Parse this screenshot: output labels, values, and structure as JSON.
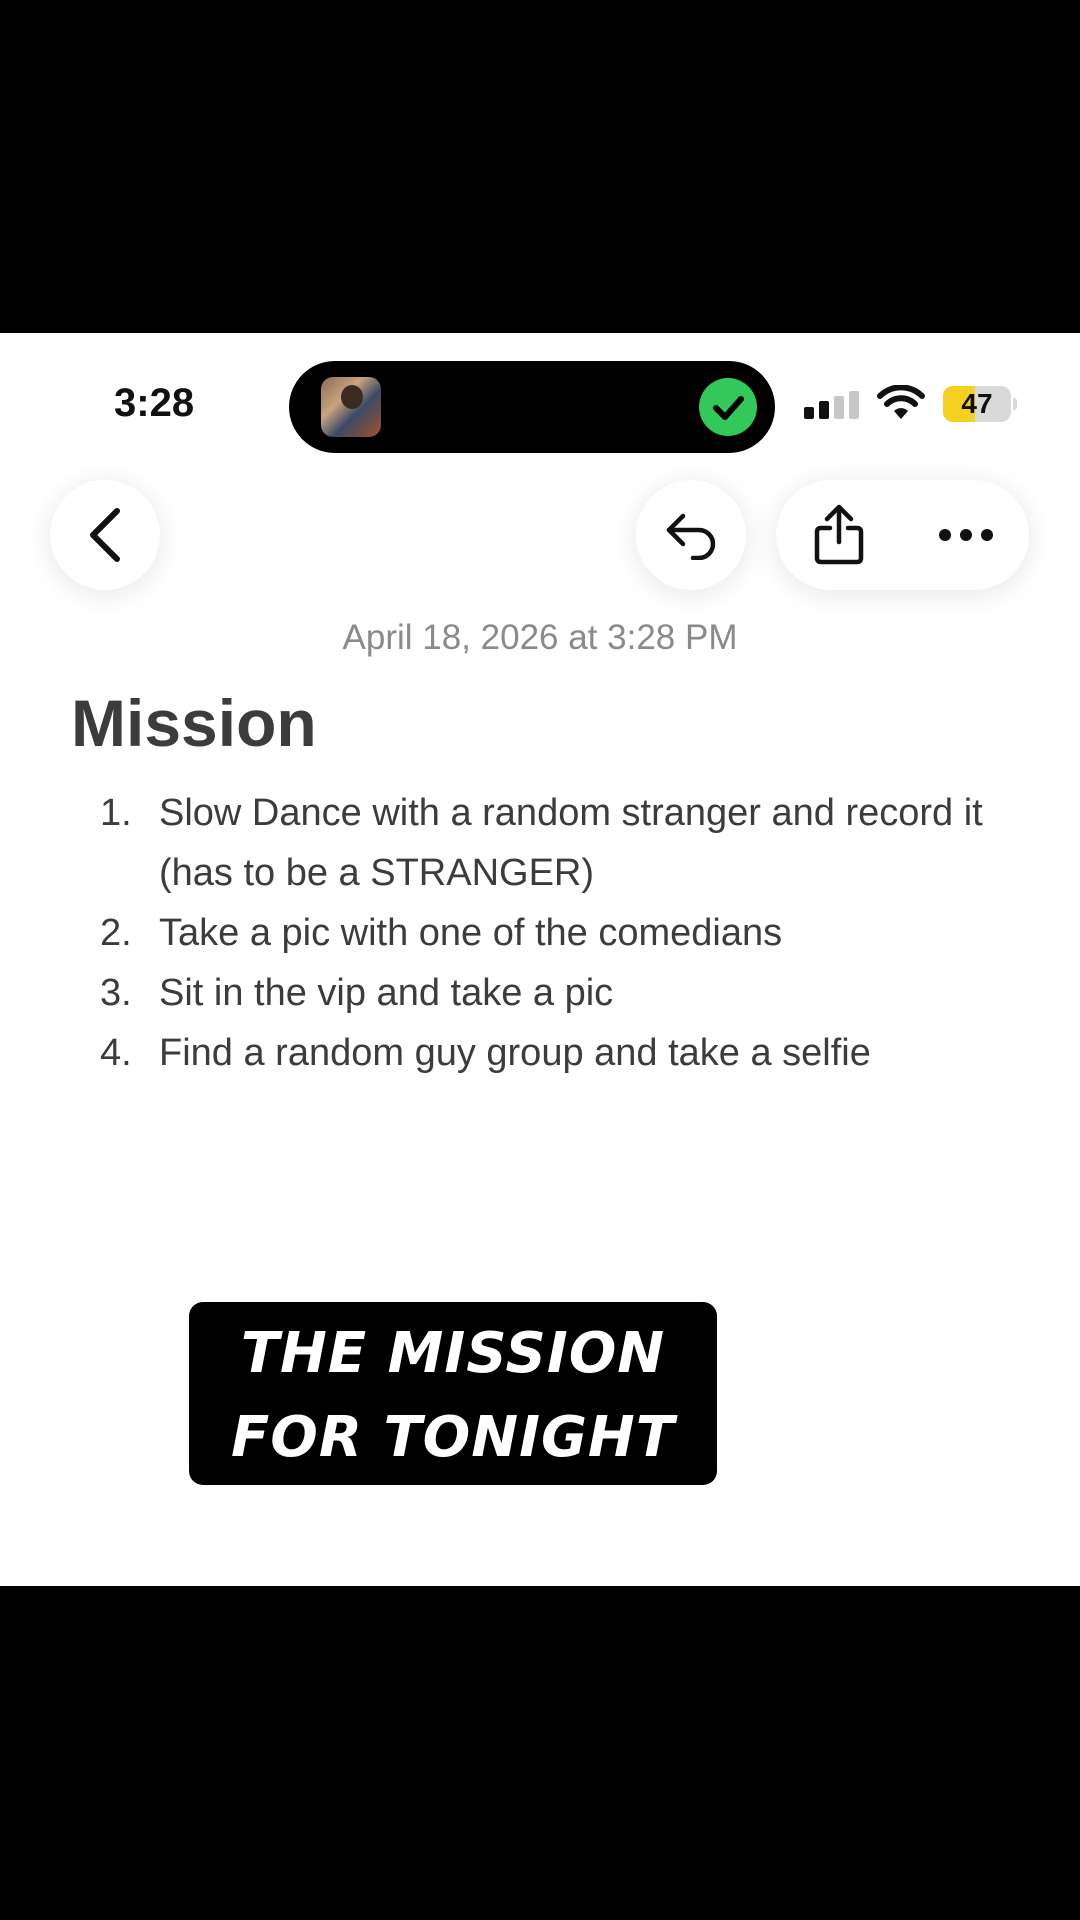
{
  "status_bar": {
    "time": "3:28",
    "battery_level": "47",
    "battery_fraction": 0.47,
    "signal_bars_active": 2,
    "signal_bars_total": 4,
    "icons": [
      "island-thumbnail",
      "check-icon",
      "cellular-signal-icon",
      "wifi-icon",
      "battery-icon"
    ],
    "check_color": "#34c759",
    "battery_color": "#f5d020"
  },
  "toolbar": {
    "icons": [
      "chevron-left-icon",
      "undo-icon",
      "share-icon",
      "more-icon"
    ]
  },
  "note": {
    "date": "April 18, 2026 at 3:28 PM",
    "title": "Mission",
    "items": [
      {
        "num": "1.",
        "text": "Slow Dance with a random stranger and record it (has to be a STRANGER)"
      },
      {
        "num": "2.",
        "text": "Take a pic with one of the comedians"
      },
      {
        "num": "3.",
        "text": "Sit in the vip and take a pic"
      },
      {
        "num": "4.",
        "text": "Find a random guy group and take a selfie"
      }
    ]
  },
  "caption": {
    "line1": "THE MISSION",
    "line2": "FOR TONIGHT"
  }
}
